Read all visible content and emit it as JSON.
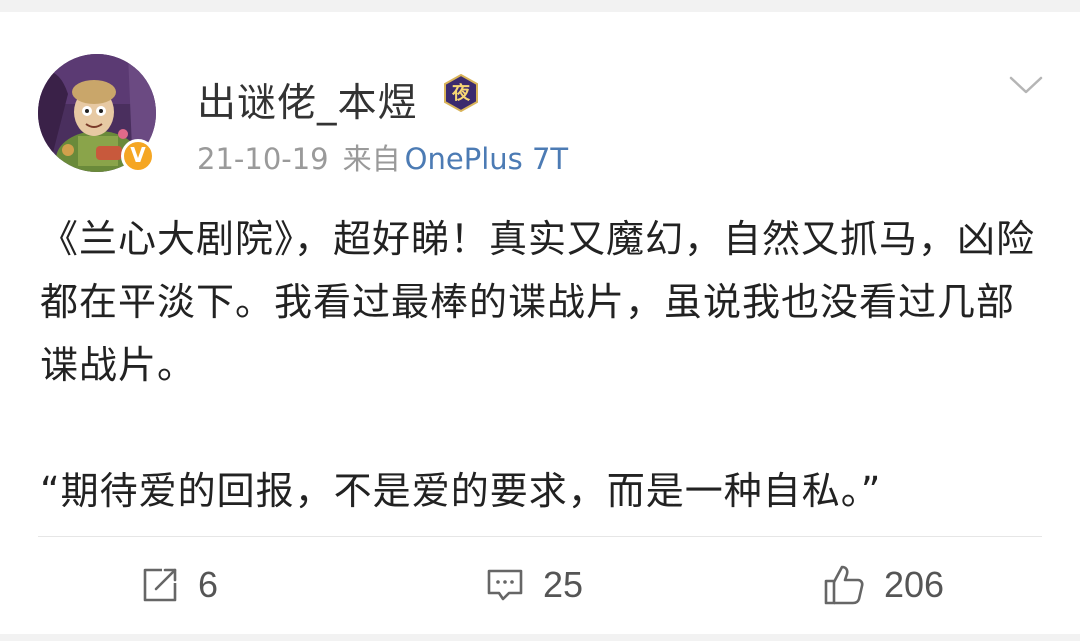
{
  "post": {
    "author": {
      "name": "出谜佬_本煜",
      "member_badge_char": "夜",
      "verified_mark": "V"
    },
    "date": "21-10-19",
    "source_prefix": "来自",
    "device": "OnePlus 7T",
    "paragraphs": [
      "《兰心大剧院》，超好睇！真实又魔幻，自然又抓马，凶险都在平淡下。我看过最棒的谍战片，虽说我也没看过几部谍战片。",
      "“期待爱的回报，不是爱的要求，而是一种自私。”"
    ]
  },
  "actions": {
    "repost_count": "6",
    "comment_count": "25",
    "like_count": "206"
  },
  "icons": {
    "repost": "repost-icon",
    "comment": "comment-icon",
    "like": "thumbs-up-icon",
    "more": "chevron-down-icon"
  },
  "colors": {
    "verified": "#f5a623",
    "link": "#4c7bb4",
    "badge_bg": "#3b2a6e"
  }
}
